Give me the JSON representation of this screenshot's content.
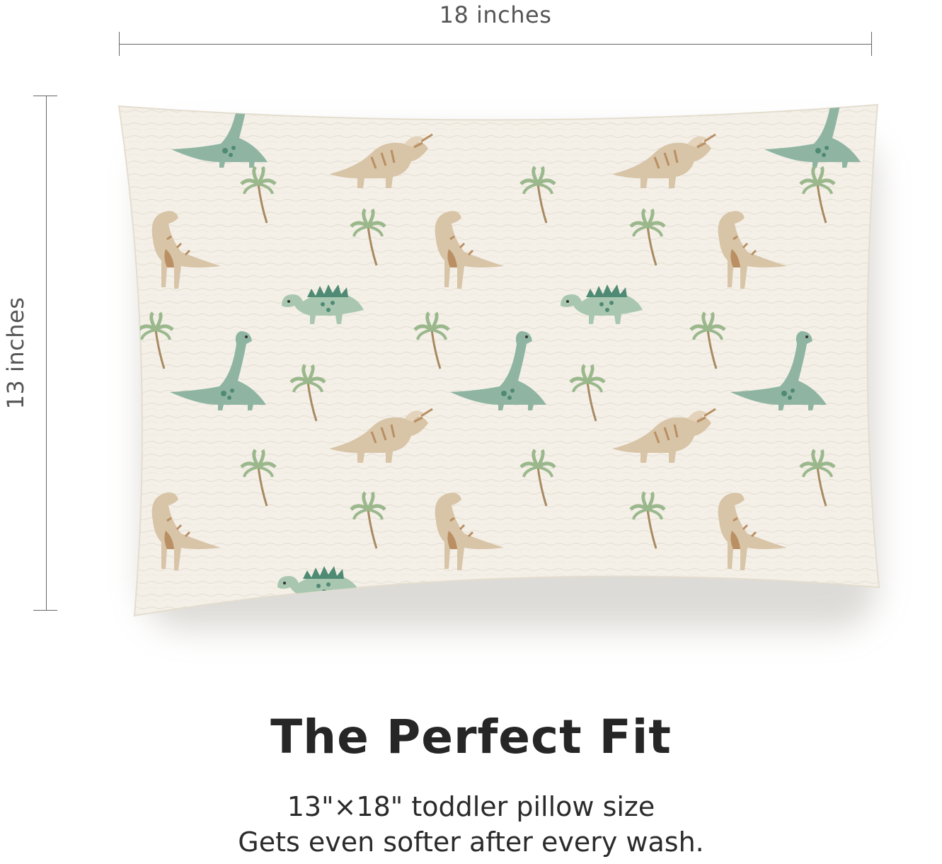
{
  "dimensions": {
    "width_label": "18 inches",
    "height_label": "13 inches"
  },
  "headline": "The Perfect Fit",
  "subtext": {
    "line1": "13\"×18\" toddler pillow size",
    "line2": "Gets even softer after every wash."
  },
  "colors": {
    "pillow_fabric": "#f4f0e8",
    "dino_tan": "#d8c4a6",
    "dino_tan_dark": "#b98f63",
    "dino_sage": "#8fb5a2",
    "dino_sage_dark": "#4f8a74",
    "palm": "#9bb88d",
    "palm_trunk": "#a88a62",
    "text": "#262626"
  },
  "pattern_icons": [
    "triceratops-icon",
    "trex-icon",
    "stegosaurus-icon",
    "brachiosaurus-icon",
    "palm-tree-icon"
  ]
}
